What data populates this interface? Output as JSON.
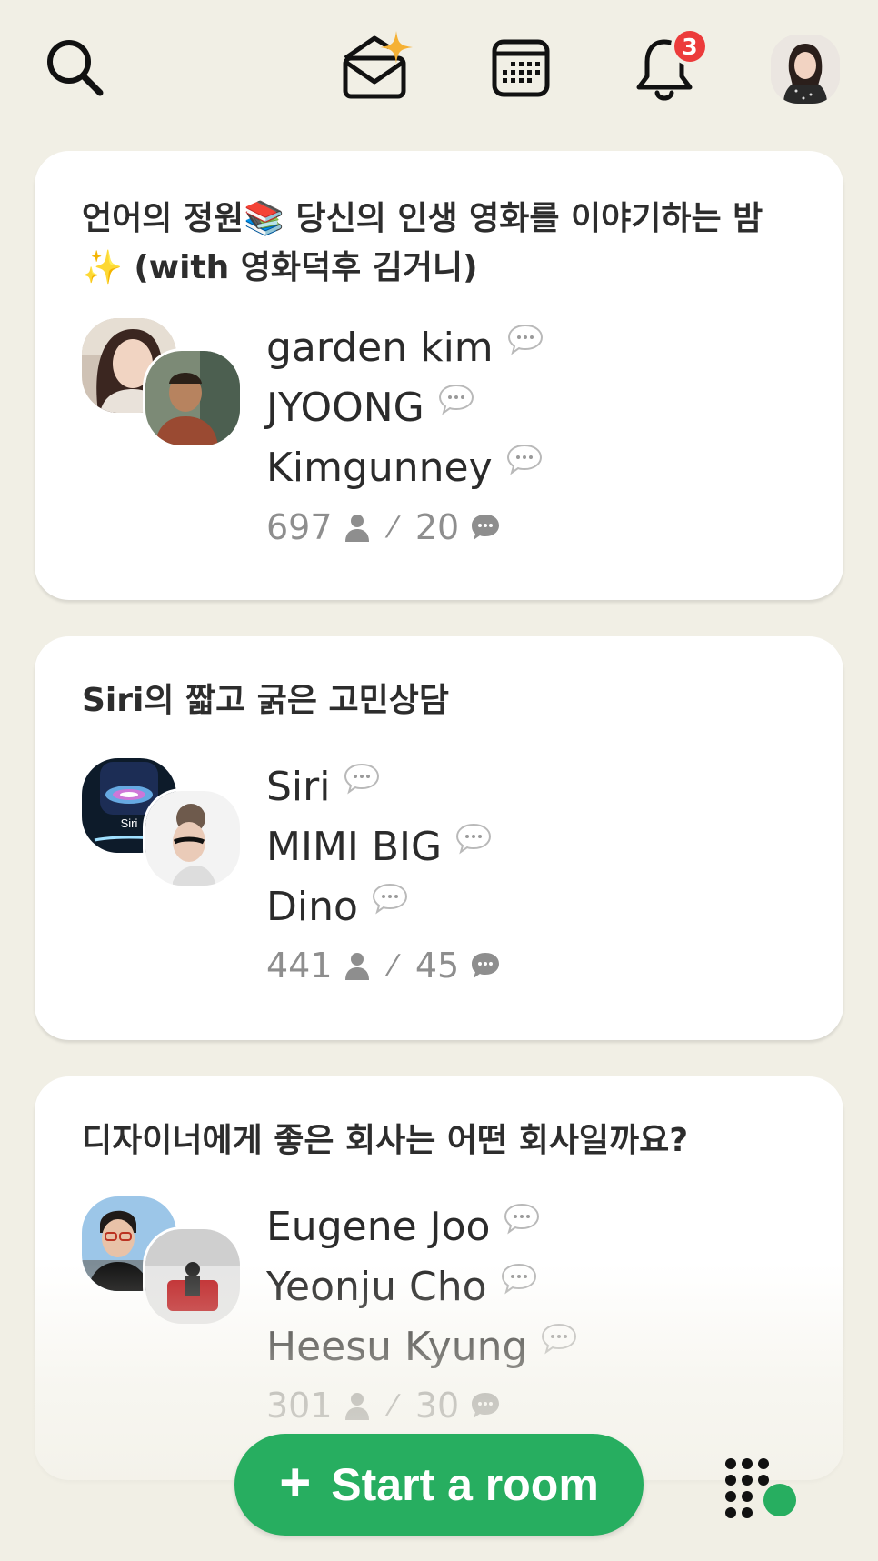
{
  "header": {
    "icons": [
      "search-icon",
      "invite-envelope-icon",
      "calendar-icon",
      "bell-icon",
      "profile-avatar"
    ],
    "notification_count": "3"
  },
  "rooms": [
    {
      "title": "언어의 정원📚 당신의 인생 영화를 이야기하는 밤 ✨ (with 영화덕후 김거니)",
      "speakers": [
        "garden kim",
        "JYOONG",
        "Kimgunney"
      ],
      "listeners": "697",
      "speakers_count": "20"
    },
    {
      "title": "Siri의 짧고 굵은 고민상담",
      "avatar_label": "Siri",
      "speakers": [
        "Siri",
        "MIMI BIG",
        "Dino"
      ],
      "listeners": "441",
      "speakers_count": "45"
    },
    {
      "title": "디자이너에게 좋은 회사는 어떤 회사일까요?",
      "speakers": [
        "Eugene Joo",
        "Yeonju Cho",
        "Heesu Kyung"
      ],
      "listeners": "301",
      "speakers_count": "30"
    }
  ],
  "footer": {
    "start_room_label": "Start a room",
    "start_room_plus": "+",
    "colors": {
      "accent": "#27ae60",
      "badge": "#ec3b3b",
      "background": "#f1efe5"
    }
  }
}
